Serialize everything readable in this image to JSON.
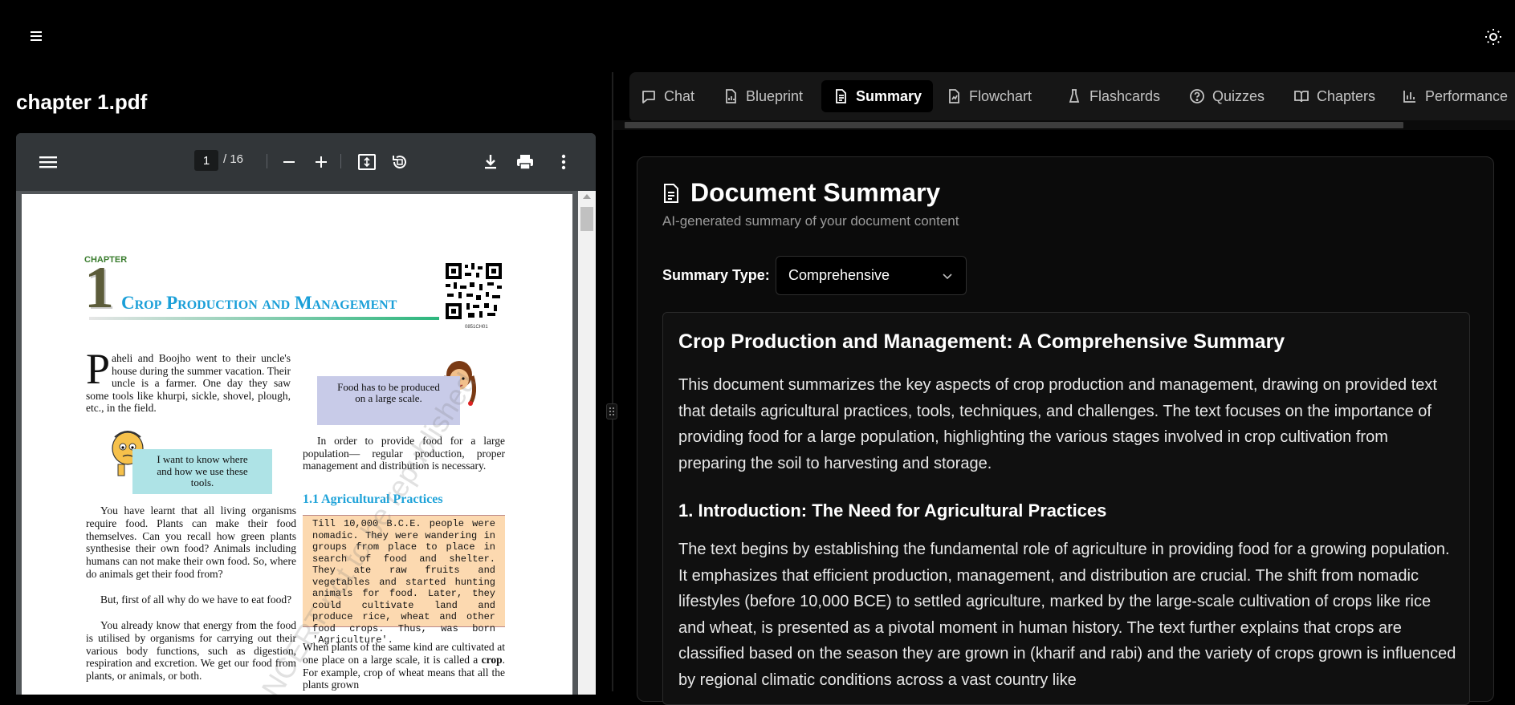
{
  "header": {
    "menu_icon": "hamburger-menu-icon",
    "theme_icon": "sun-icon"
  },
  "document": {
    "file_name": "chapter 1.pdf"
  },
  "pdf_viewer": {
    "current_page": "1",
    "total_pages": "/ 16",
    "toolbar_icons": [
      "menu-icon",
      "zoom-out-icon",
      "zoom-in-icon",
      "fit-page-icon",
      "rotate-icon",
      "download-icon",
      "print-icon",
      "more-vert-icon"
    ],
    "page": {
      "chapter_label": "CHAPTER",
      "chapter_number": "1",
      "chapter_title": "Crop Production and Management",
      "qr_code_id": "0851CH01",
      "intro_para": "aheli and Boojho went to their uncle's house during the summer vacation. Their uncle is a farmer. One day they saw some tools like khurpi, sickle, shovel, plough, etc., in the field.",
      "intro_dropcap": "P",
      "speech_1": "Food has to be produced on a large scale.",
      "speech_2": "I want to know where and how we use these tools.",
      "right_para": "In order to provide food for a large population— regular production, proper management and distribution is necessary.",
      "section_heading": "1.1 Agricultural Practices",
      "box_text": "Till 10,000 B.C.E. people were nomadic. They were wandering in groups from place to place in search of food and shelter. They ate raw fruits and vegetables and started hunting animals for food. Later, they could cultivate land and produce rice, wheat and other food crops. Thus, was born 'Agriculture'.",
      "left_para_1": "You have learnt that all living organisms require food. Plants can make their food themselves. Can you recall how green plants synthesise their own food? Animals including humans can not make their own food. So, where do animals get their food from?",
      "left_para_2": "But, first of all why do we have to eat food?",
      "left_para_3": "You already know that energy from the food is utilised by organisms for carrying out their various body functions, such as digestion, respiration and excretion. We get our food from plants, or animals, or both.",
      "right_para_2_a": "When plants of the same kind are cultivated at one place on a large scale, it is called a ",
      "right_para_2_bold": "crop",
      "right_para_2_b": ". For example, crop of wheat means that all the plants grown",
      "watermark": "© NCERT not to be republished"
    }
  },
  "tabs": [
    {
      "label": "Chat",
      "icon": "chat-icon",
      "active": false
    },
    {
      "label": "Blueprint",
      "icon": "file-chart-icon",
      "active": false
    },
    {
      "label": "Summary",
      "icon": "file-text-icon",
      "active": true
    },
    {
      "label": "Flowchart",
      "icon": "file-chart-icon",
      "active": false
    },
    {
      "label": "Flashcards",
      "icon": "flask-icon",
      "active": false
    },
    {
      "label": "Quizzes",
      "icon": "help-circle-icon",
      "active": false
    },
    {
      "label": "Chapters",
      "icon": "book-open-icon",
      "active": false
    },
    {
      "label": "Performance",
      "icon": "bar-chart-icon",
      "active": false
    }
  ],
  "summary_panel": {
    "title": "Document Summary",
    "subtitle": "AI-generated summary of your document content",
    "type_label": "Summary Type:",
    "type_value": "Comprehensive",
    "content": {
      "heading": "Crop Production and Management: A Comprehensive Summary",
      "intro": "This document summarizes the key aspects of crop production and management, drawing on provided text that details agricultural practices, tools, techniques, and challenges. The text focuses on the importance of providing food for a large population, highlighting the various stages involved in crop cultivation from preparing the soil to harvesting and storage.",
      "section_1_heading": "1. Introduction: The Need for Agricultural Practices",
      "section_1_text": "The text begins by establishing the fundamental role of agriculture in providing food for a growing population. It emphasizes that efficient production, management, and distribution are crucial. The shift from nomadic lifestyles (before 10,000 BCE) to settled agriculture, marked by the large-scale cultivation of crops like rice and wheat, is presented as a pivotal moment in human history. The text further explains that crops are classified based on the season they are grown in (kharif and rabi) and the variety of crops grown is influenced by regional climatic conditions across a vast country like"
    }
  },
  "colors": {
    "background": "#000000",
    "panel": "#0b0b0b",
    "tab_bar": "#161616",
    "pdf_toolbar": "#323639",
    "chapter_title_blue": "#1a9fd8",
    "section_blue": "#1fa3d9",
    "speech_bubble_1": "#c8cbe8",
    "speech_bubble_2": "#aee3e6",
    "info_box": "#fcd9b0"
  }
}
